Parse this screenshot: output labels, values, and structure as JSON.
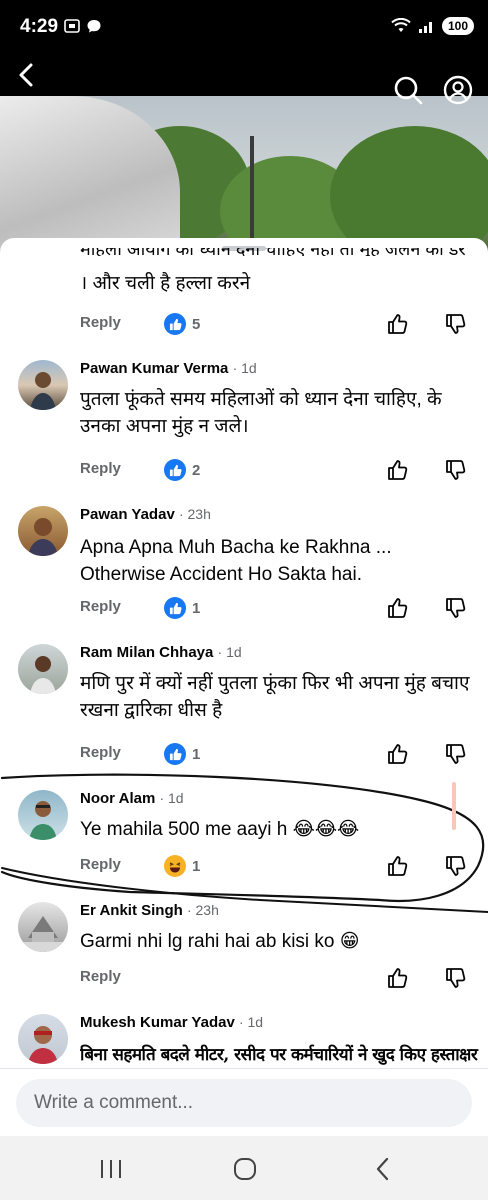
{
  "status_bar": {
    "time": "4:29",
    "battery": "100"
  },
  "comments": [
    {
      "name": "",
      "time": "",
      "text": "। और चली है हल्ला करने",
      "reply_label": "Reply",
      "reaction_type": "like",
      "reaction_count": "5"
    },
    {
      "name": "Pawan Kumar Verma",
      "time": "· 1d",
      "text": "पुतला फूंकते समय महिलाओं को ध्यान देना चाहिए, के उनका अपना मुंह न जले।",
      "reply_label": "Reply",
      "reaction_type": "like",
      "reaction_count": "2"
    },
    {
      "name": "Pawan Yadav",
      "time": "· 23h",
      "text": "Apna Apna Muh Bacha ke Rakhna ... Otherwise Accident Ho Sakta hai.",
      "reply_label": "Reply",
      "reaction_type": "like",
      "reaction_count": "1"
    },
    {
      "name": "Ram Milan Chhaya",
      "time": "· 1d",
      "text": "मणि पुर में क्यों नहीं पुतला फूंका  फिर भी अपना मुंह बचाए रखना द्वारिका धीस है",
      "reply_label": "Reply",
      "reaction_type": "like",
      "reaction_count": "1"
    },
    {
      "name": "Noor Alam",
      "time": "· 1d",
      "text": "Ye mahila 500 me aayi h 😂😂😂",
      "reply_label": "Reply",
      "reaction_type": "haha",
      "reaction_count": "1"
    },
    {
      "name": "Er Ankit Singh",
      "time": "· 23h",
      "text": "Garmi nhi lg rahi hai ab kisi ko 😁",
      "reply_label": "Reply",
      "reaction_type": "",
      "reaction_count": ""
    },
    {
      "name": "Mukesh Kumar Yadav",
      "time": "· 1d",
      "text": "बिना सहमति बदले मीटर, रसीद पर कर्मचारियों ने खुद किए हस्ताक्षर",
      "reply_label": "",
      "reaction_type": "",
      "reaction_count": ""
    }
  ],
  "comment_box": {
    "placeholder": "Write a comment..."
  },
  "colors": {
    "accent": "#1877f2",
    "secondary_text": "#65676b",
    "haha": "#f7b125"
  }
}
